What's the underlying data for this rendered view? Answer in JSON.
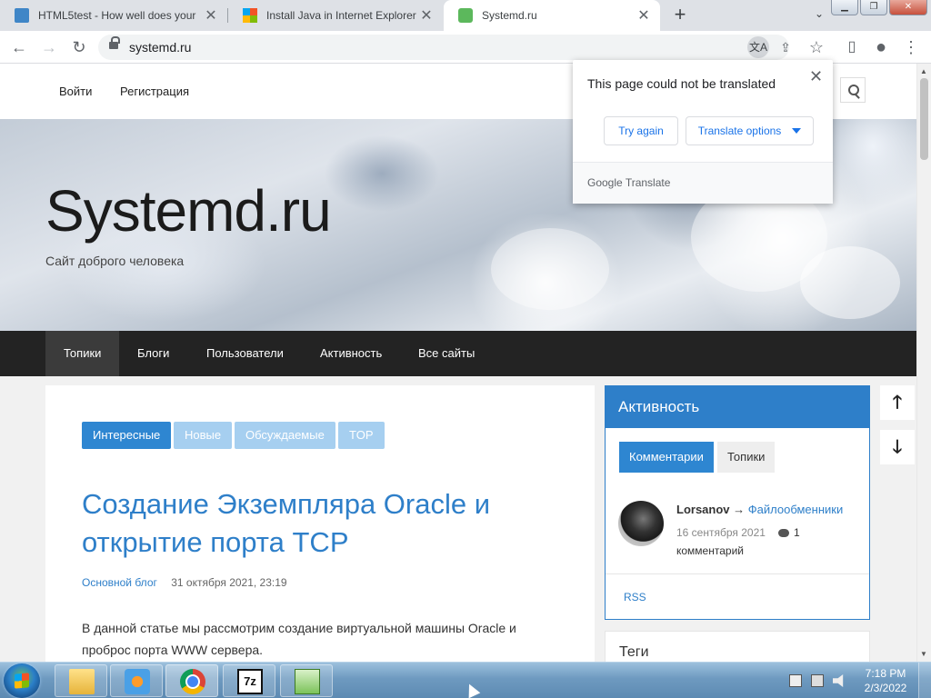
{
  "browser": {
    "tabs": [
      {
        "title": "HTML5test - How well does your"
      },
      {
        "title": "Install Java in Internet Explorer"
      },
      {
        "title": "Systemd.ru"
      }
    ],
    "new_tab": "+",
    "tab_dropdown": "⌄",
    "window_buttons": {
      "minimize": "▁",
      "maximize": "❐",
      "close": "✕"
    },
    "url": "systemd.ru",
    "nav_icons": {
      "back": "←",
      "forward": "→",
      "reload": "↻"
    },
    "toolbar_icons": {
      "translate": "文A",
      "share": "⇪",
      "bookmark": "☆",
      "sidepanel": "▯",
      "profile": "●",
      "menu": "⋮"
    }
  },
  "translate_popup": {
    "message": "This page could not be translated",
    "close": "✕",
    "try_again": "Try again",
    "options": "Translate options",
    "footer": "Google Translate"
  },
  "site": {
    "top_links": {
      "login": "Войти",
      "register": "Регистрация"
    },
    "title": "Systemd.ru",
    "subtitle": "Сайт доброго человека",
    "nav": [
      "Топики",
      "Блоги",
      "Пользователи",
      "Активность",
      "Все сайты"
    ],
    "filters": [
      "Интересные",
      "Новые",
      "Обсуждаемые",
      "TOP"
    ],
    "post": {
      "title": "Создание Экземпляра Oracle и открытие порта TCP",
      "blog": "Основной блог",
      "date": "31 октября 2021, 23:19",
      "text": "В данной статье мы рассмотрим создание виртуальной машины Oracle и проброс порта WWW сервера."
    },
    "sidebar": {
      "title": "Активность",
      "tabs": [
        "Комментарии",
        "Топики"
      ],
      "item": {
        "user": "Lorsanov",
        "arrow": "→",
        "target": "Файлообменники",
        "date": "16 сентября 2021",
        "count": "1",
        "count_label": "комментарий"
      },
      "rss": "RSS"
    },
    "tags_title": "Теги",
    "scroll_up": "🡑",
    "scroll_down": "🡓"
  },
  "taskbar": {
    "apps": [
      "Windows Explorer",
      "Windows Media Player",
      "Google Chrome",
      "7-Zip",
      "Notepad++"
    ],
    "app_7z_label": "7z",
    "time": "7:18 PM",
    "date": "2/3/2022"
  },
  "colors": {
    "accent": "#2e7fc9",
    "nav_bg": "#232323",
    "pill_active": "#2e86d1",
    "pill_inactive": "#a6cff0"
  }
}
